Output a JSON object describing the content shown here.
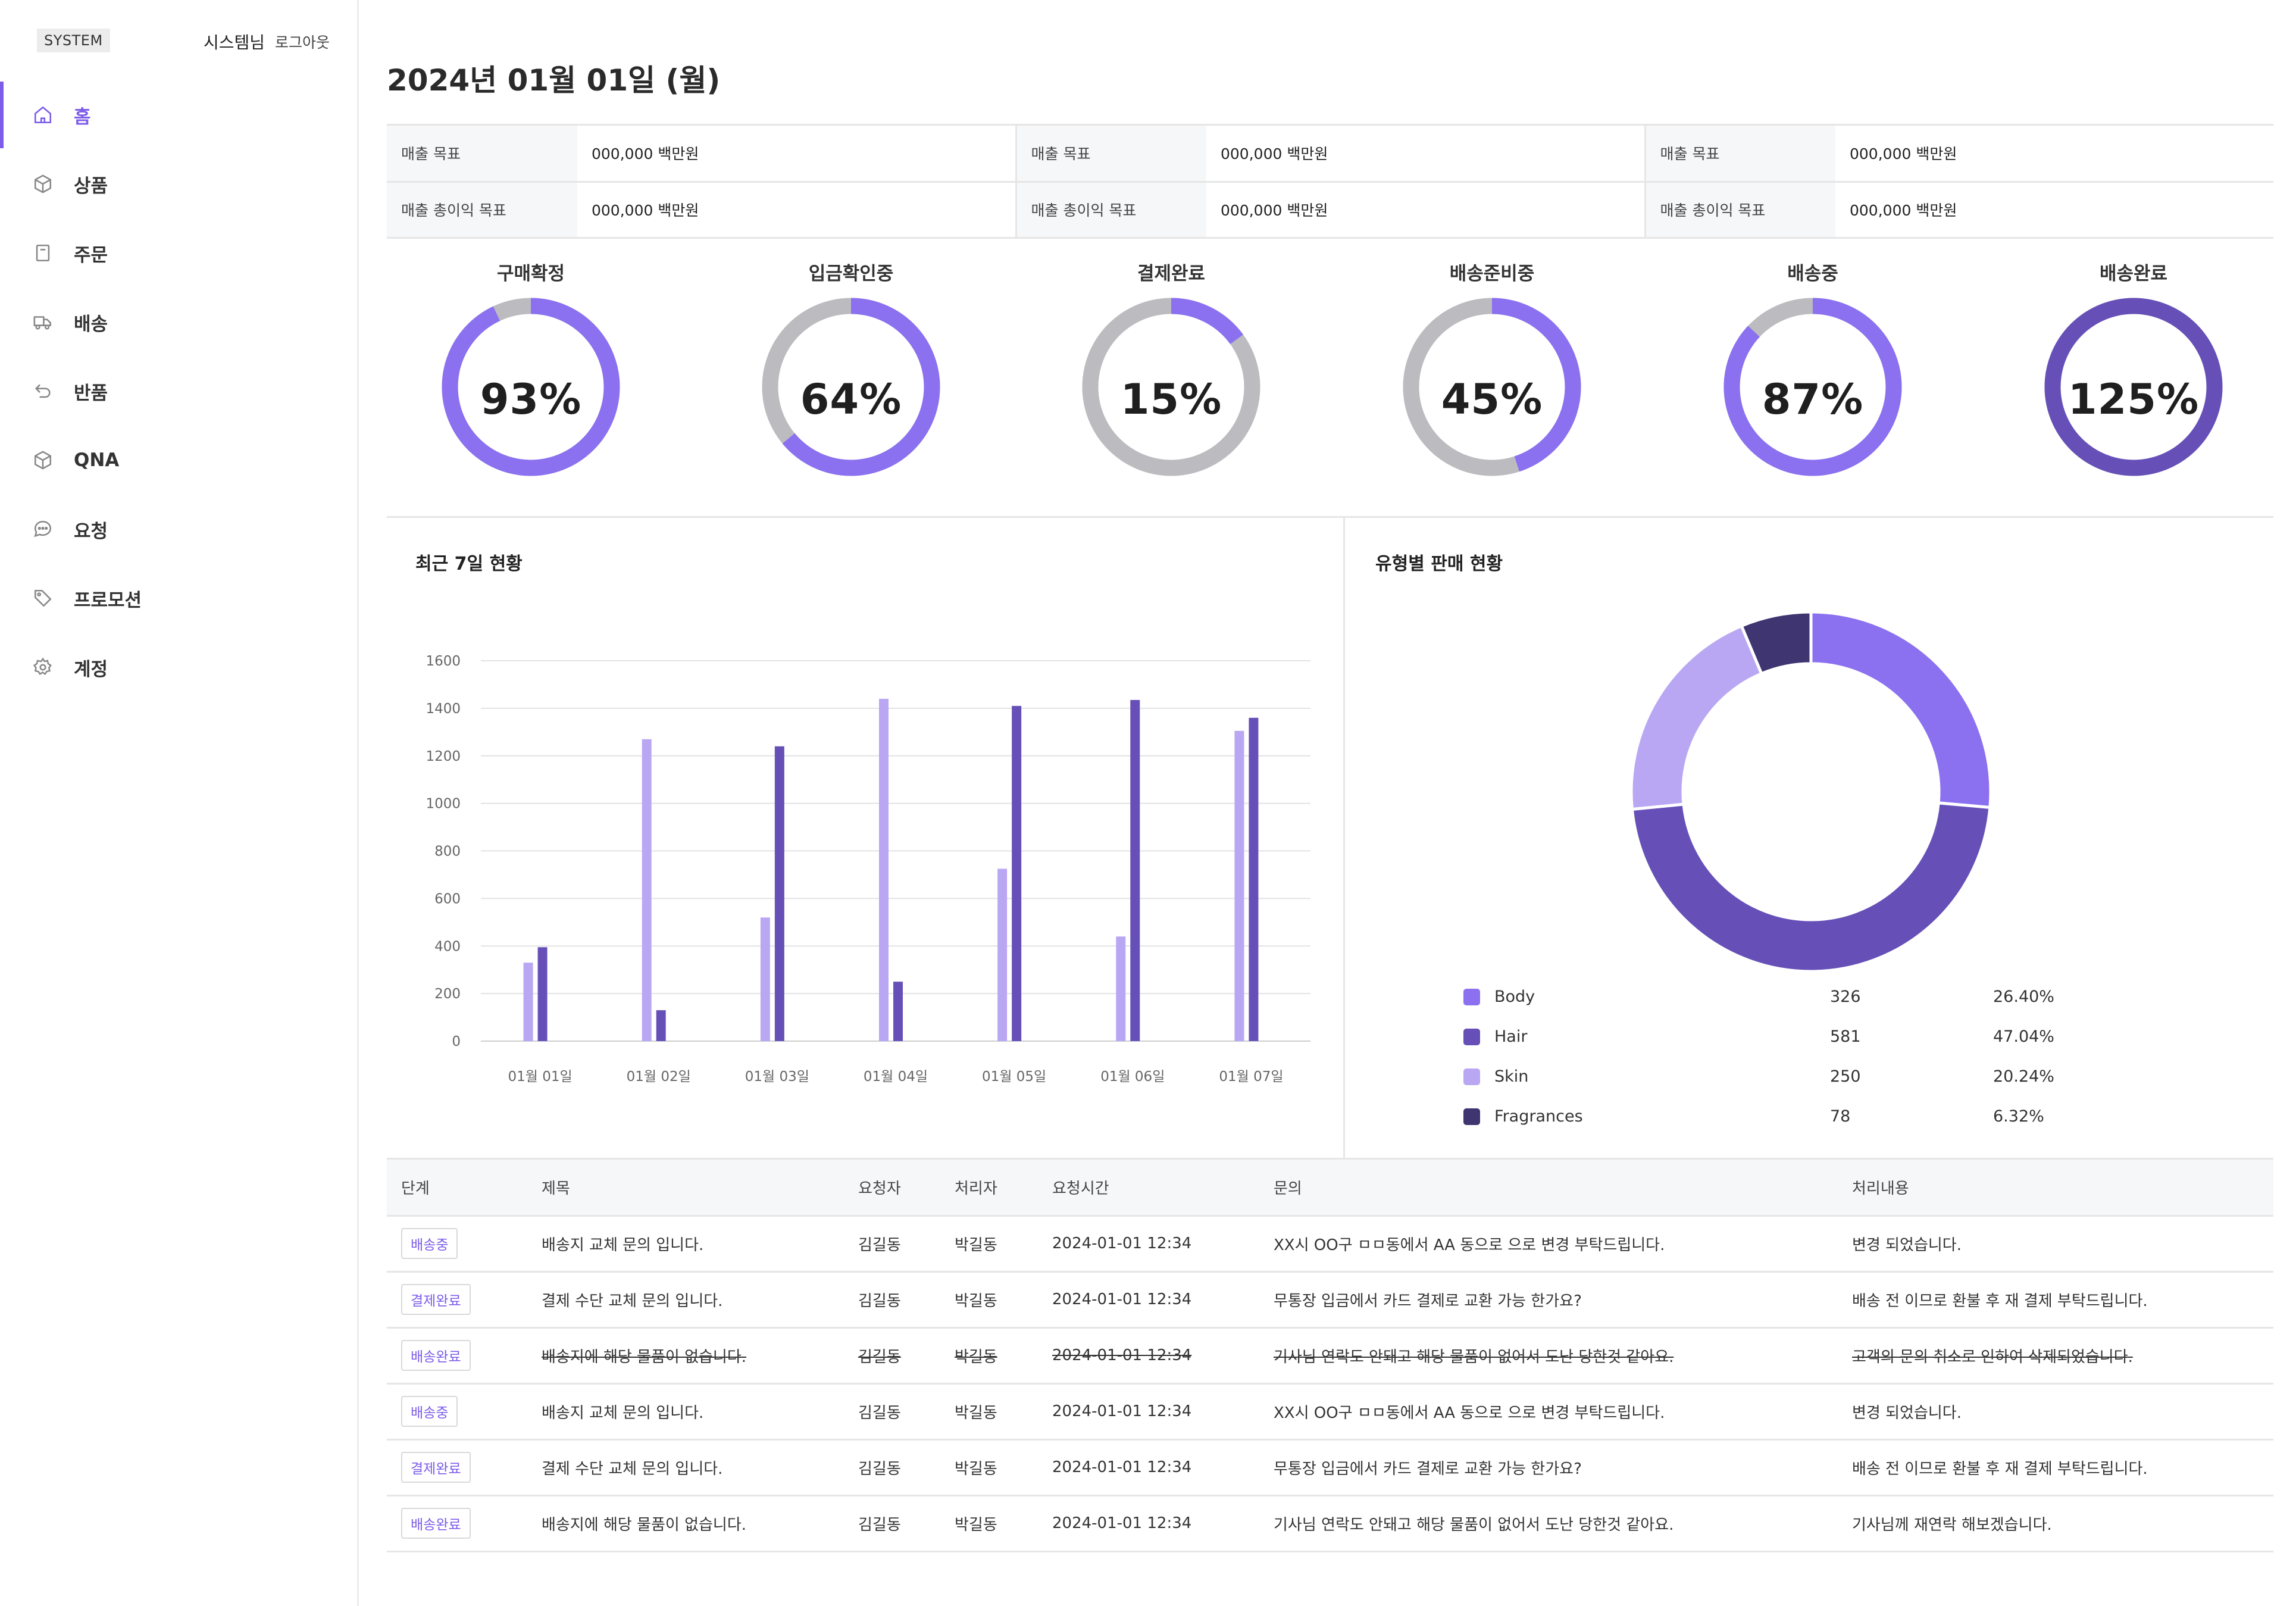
{
  "header": {
    "system_badge": "SYSTEM",
    "user_name": "시스템님",
    "logout": "로그아웃"
  },
  "sidebar": {
    "items": [
      {
        "label": "홈",
        "icon": "home-icon",
        "active": true
      },
      {
        "label": "상품",
        "icon": "box-icon"
      },
      {
        "label": "주문",
        "icon": "receipt-icon"
      },
      {
        "label": "배송",
        "icon": "truck-icon"
      },
      {
        "label": "반품",
        "icon": "return-icon"
      },
      {
        "label": "QNA",
        "icon": "box-icon"
      },
      {
        "label": "요청",
        "icon": "chat-icon"
      },
      {
        "label": "프로모션",
        "icon": "tag-icon"
      },
      {
        "label": "계정",
        "icon": "gear-icon"
      }
    ]
  },
  "page": {
    "title": "2024년 01월 01일 (월)"
  },
  "targets": {
    "rows": [
      [
        {
          "label": "매출 목표",
          "value": "000,000 백만원"
        },
        {
          "label": "매출 목표",
          "value": "000,000 백만원"
        },
        {
          "label": "매출 목표",
          "value": "000,000 백만원"
        }
      ],
      [
        {
          "label": "매출 총이익 목표",
          "value": "000,000 백만원"
        },
        {
          "label": "매출 총이익 목표",
          "value": "000,000 백만원"
        },
        {
          "label": "매출 총이익 목표",
          "value": "000,000 백만원"
        }
      ]
    ]
  },
  "progress": [
    {
      "title": "구매확정",
      "pct_label": "93%",
      "fraction": 0.93,
      "color": "#8b70f0"
    },
    {
      "title": "입금확인중",
      "pct_label": "64%",
      "fraction": 0.64,
      "color": "#8b70f0"
    },
    {
      "title": "결제완료",
      "pct_label": "15%",
      "fraction": 0.15,
      "color": "#8b70f0"
    },
    {
      "title": "배송준비중",
      "pct_label": "45%",
      "fraction": 0.45,
      "color": "#8b70f0"
    },
    {
      "title": "배송중",
      "pct_label": "87%",
      "fraction": 0.87,
      "color": "#8b70f0"
    },
    {
      "title": "배송완료",
      "pct_label": "125%",
      "fraction": 1.0,
      "color": "#6650b8"
    }
  ],
  "panels": {
    "weekly_title": "최근 7일 현황",
    "category_title": "유형별 판매 현황"
  },
  "chart_data": [
    {
      "type": "bar",
      "categories": [
        "01월 01일",
        "01월 02일",
        "01월 03일",
        "01월 04일",
        "01월 05일",
        "01월 06일",
        "01월 07일"
      ],
      "series": [
        {
          "values": [
            330,
            1270,
            520,
            1440,
            725,
            440,
            1305
          ],
          "color": "#b9a7f4"
        },
        {
          "values": [
            395,
            130,
            1240,
            250,
            1410,
            1435,
            1360
          ],
          "color": "#6650b8"
        }
      ],
      "yticks": [
        "0",
        "200",
        "400",
        "600",
        "800",
        "1000",
        "1200",
        "1400",
        "1600"
      ],
      "ylim": [
        0,
        1600
      ],
      "grid": true
    },
    {
      "type": "pie",
      "labels": [
        "Body",
        "Hair",
        "Skin",
        "Fragrances"
      ],
      "values": [
        326,
        581,
        250,
        78
      ],
      "percents": [
        "26.40%",
        "47.04%",
        "20.24%",
        "6.32%"
      ],
      "colors": [
        "#8b70f0",
        "#6650b8",
        "#b9a7f4",
        "#3f3570"
      ]
    }
  ],
  "requests": {
    "headers": [
      "단계",
      "제목",
      "요청자",
      "처리자",
      "요청시간",
      "문의",
      "처리내용"
    ],
    "rows": [
      {
        "status": "배송중",
        "title": "배송지 교체 문의 입니다.",
        "requester": "김길동",
        "handler": "박길동",
        "time": "2024-01-01 12:34",
        "question": "XX시 OO구 ㅁㅁ동에서 AA 동으로 으로 변경 부탁드립니다.",
        "result": "변경 되었습니다.",
        "struck": false
      },
      {
        "status": "결제완료",
        "title": "결제 수단 교체 문의 입니다.",
        "requester": "김길동",
        "handler": "박길동",
        "time": "2024-01-01 12:34",
        "question": "무통장 입금에서 카드 결제로 교환 가능 한가요?",
        "result": "배송 전 이므로 환불 후 재 결제 부탁드립니다.",
        "struck": false
      },
      {
        "status": "배송완료",
        "title": "배송지에 해당 물품이 없습니다.",
        "requester": "김길동",
        "handler": "박길동",
        "time": "2024-01-01 12:34",
        "question": "기사님 연락도 안돼고 해당 물품이 없어서 도난 당한것 같아요.",
        "result": "고객의 문의 취소로 인하여 삭제되었습니다.",
        "struck": true
      },
      {
        "status": "배송중",
        "title": "배송지 교체 문의 입니다.",
        "requester": "김길동",
        "handler": "박길동",
        "time": "2024-01-01 12:34",
        "question": "XX시 OO구 ㅁㅁ동에서 AA 동으로 으로 변경 부탁드립니다.",
        "result": "변경 되었습니다.",
        "struck": false
      },
      {
        "status": "결제완료",
        "title": "결제 수단 교체 문의 입니다.",
        "requester": "김길동",
        "handler": "박길동",
        "time": "2024-01-01 12:34",
        "question": "무통장 입금에서 카드 결제로 교환 가능 한가요?",
        "result": "배송 전 이므로 환불 후 재 결제 부탁드립니다.",
        "struck": false
      },
      {
        "status": "배송완료",
        "title": "배송지에 해당 물품이 없습니다.",
        "requester": "김길동",
        "handler": "박길동",
        "time": "2024-01-01 12:34",
        "question": "기사님 연락도 안돼고 해당 물품이 없어서 도난 당한것 같아요.",
        "result": "기사님께 재연락 해보겠습니다.",
        "struck": false
      }
    ]
  }
}
